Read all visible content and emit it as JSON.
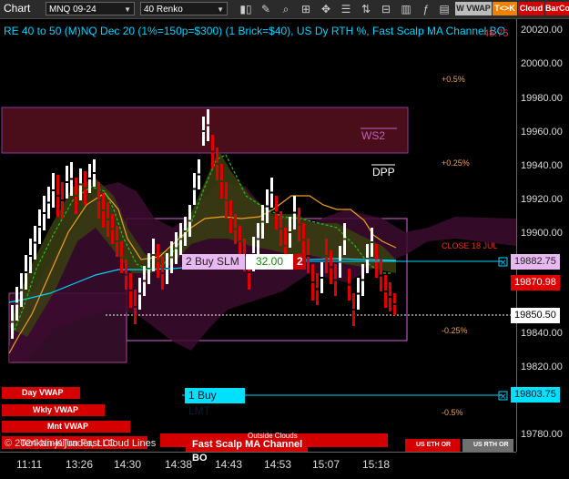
{
  "toolbar": {
    "chart_label": "Chart",
    "instrument": "MNQ 09-24",
    "bar_type": "40 Renko",
    "tags": [
      "W VWAP",
      "T<>K",
      "Cloud",
      "BarCo"
    ]
  },
  "chart": {
    "title": "RE 40 to 50 (M)NQ Dec 20 (1%=150p=$300) (1 Brick=$40), US Dy RTH %, Fast Scalp MA Channel BO",
    "title_overlay_value": "48.75",
    "pct_labels": [
      "+0.5%",
      "+0.25%",
      "-0.25%",
      "-0.5%"
    ],
    "ws2_label": "WS2",
    "dpp_label": "DPP",
    "close_label": "CLOSE 18 JUL",
    "buy_slm_label": "2 Buy SLM",
    "buy_slm_price": "32.00",
    "buy_slm_qty": "2",
    "buy_lmt_label": "1 Buy LMT",
    "copyright": "© 2024 NinjaTrader, LLC",
    "overlay_text": "Tenkan-Kijun Fast Cloud Lines",
    "outside_clouds": "Outside Clouds",
    "fast_scalp_label": "Fast Scalp MA Channel BO",
    "vwap_labels": [
      "Day VWAP",
      "Wkly VWAP",
      "Mnt VWAP"
    ],
    "session_labels": [
      "US ETH OR",
      "US RTH OR"
    ]
  },
  "price_axis": {
    "ticks": [
      "20020.00",
      "20000.00",
      "19980.00",
      "19960.00",
      "19940.00",
      "19920.00",
      "19900.00",
      "19840.00",
      "19820.00",
      "19780.00"
    ],
    "pills": {
      "slm": "19882.75",
      "last": "19870.98",
      "current": "19850.50",
      "lmt": "19803.75"
    }
  },
  "time_axis": {
    "ticks": [
      "11:11",
      "13:26",
      "14:30",
      "14:38",
      "14:43",
      "14:53",
      "15:07",
      "15:18"
    ]
  },
  "colors": {
    "up": "#ffffff",
    "down": "#e00000",
    "cyan": "#00d4ff",
    "orange": "#f0a020",
    "purple": "#c060c0",
    "green": "#20c020"
  }
}
